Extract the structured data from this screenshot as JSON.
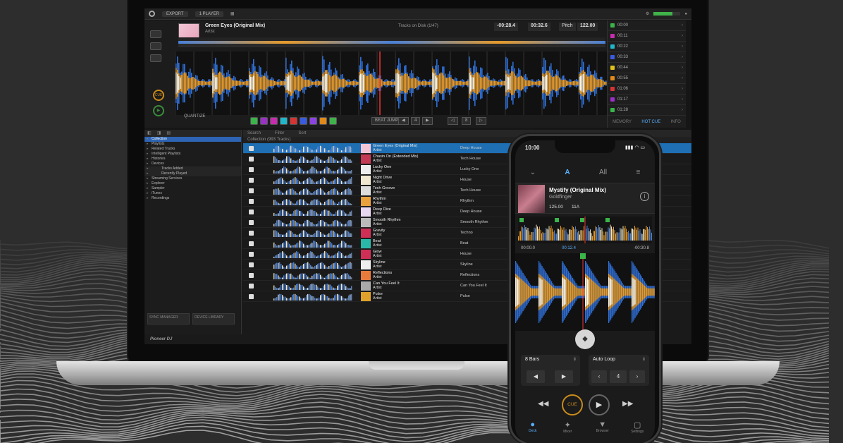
{
  "app": {
    "brand": "Pioneer DJ"
  },
  "topbar": {
    "mode_label": "EXPORT",
    "layout_label": "1 PLAYER"
  },
  "deck": {
    "title": "Green Eyes (Original Mix)",
    "artist": "Artist",
    "key": "Tracks on Disk (1/47)",
    "time_remaining": "-00:28.4",
    "time_elapsed": "00:32.6",
    "pitch_label": "Pitch",
    "bpm": "122.00",
    "cue_label": "CUE",
    "play_label": "▶",
    "quantize_label": "QUANTIZE",
    "beat_jump_label": "BEAT JUMP",
    "pad_colors": [
      "#3ab54a",
      "#9b30c9",
      "#c92bb0",
      "#1fb7c9",
      "#d63333",
      "#3a5be0",
      "#8c44e0",
      "#e08a1b",
      "#3fb24a"
    ]
  },
  "hot_cues": [
    {
      "label": "00:00",
      "color": "#3ab54a"
    },
    {
      "label": "00:11",
      "color": "#c92bb0"
    },
    {
      "label": "00:22",
      "color": "#1fb7c9"
    },
    {
      "label": "00:33",
      "color": "#3a5be0"
    },
    {
      "label": "00:44",
      "color": "#e0c21b"
    },
    {
      "label": "00:55",
      "color": "#e08a1b"
    },
    {
      "label": "01:06",
      "color": "#d63333"
    },
    {
      "label": "01:17",
      "color": "#9b30c9"
    },
    {
      "label": "01:28",
      "color": "#3ab54a"
    }
  ],
  "hot_cue_footer": [
    "MEMORY",
    "HOT CUE",
    "INFO"
  ],
  "tree": {
    "tabs": [
      "◧",
      "◨",
      "▤"
    ],
    "items": [
      {
        "label": "Collection",
        "sel": true
      },
      {
        "label": "Playlists",
        "sel": false
      },
      {
        "label": "Related Tracks",
        "sel": false
      },
      {
        "label": "Intelligent Playlists",
        "sel": false
      },
      {
        "label": "Histories",
        "sel": false
      },
      {
        "label": "Devices",
        "sel": false
      },
      {
        "label": "Tracks Added",
        "sel": false,
        "sub": true
      },
      {
        "label": "Recently Played",
        "sel": false,
        "sub": true
      },
      {
        "label": "Streaming Services",
        "sel": false
      },
      {
        "label": "Explorer",
        "sel": false
      },
      {
        "label": "Sampler",
        "sel": false
      },
      {
        "label": "iTunes",
        "sel": false
      },
      {
        "label": "Recordings",
        "sel": false
      }
    ],
    "bottom": [
      "SYNC MANAGER",
      "DEVICE LIBRARY"
    ]
  },
  "list": {
    "header": [
      "Search",
      "Filter",
      "Sort"
    ],
    "subtitle": "Collection (993 Tracks)",
    "rows": [
      {
        "title": "Green Eyes (Original Mix)",
        "artist": "Artist",
        "genre": "Deep House",
        "sel": true,
        "thumb": "#f2c6d5"
      },
      {
        "title": "Chasin On (Extended Mix)",
        "artist": "Artist",
        "genre": "Tech House",
        "sel": false,
        "thumb": "#c43a55"
      },
      {
        "title": "Lucky One",
        "artist": "Artist",
        "genre": "Lucky One",
        "sel": false,
        "thumb": "#eeeeee"
      },
      {
        "title": "Night Drive",
        "artist": "Artist",
        "genre": "House",
        "sel": false,
        "thumb": "#f0e8d0"
      },
      {
        "title": "Tech Groove",
        "artist": "Artist",
        "genre": "Tech House",
        "sel": false,
        "thumb": "#dddddd"
      },
      {
        "title": "Rhythm",
        "artist": "Artist",
        "genre": "Rhythm",
        "sel": false,
        "thumb": "#e8a13c"
      },
      {
        "title": "Deep Dive",
        "artist": "Artist",
        "genre": "Deep House",
        "sel": false,
        "thumb": "#e8d7f0"
      },
      {
        "title": "Smooth Rhythm",
        "artist": "Artist",
        "genre": "Smooth Rhythm",
        "sel": false,
        "thumb": "#bbbbbb"
      },
      {
        "title": "Gravity",
        "artist": "Artist",
        "genre": "Techno",
        "sel": false,
        "thumb": "#d02f55"
      },
      {
        "title": "Beat",
        "artist": "Artist",
        "genre": "Beat",
        "sel": false,
        "thumb": "#2bb7a8"
      },
      {
        "title": "Glow",
        "artist": "Artist",
        "genre": "House",
        "sel": false,
        "thumb": "#d02f55"
      },
      {
        "title": "Skyline",
        "artist": "Artist",
        "genre": "Skyline",
        "sel": false,
        "thumb": "#eeeeee"
      },
      {
        "title": "Reflections",
        "artist": "Artist",
        "genre": "Reflections",
        "sel": false,
        "thumb": "#e87a3c"
      },
      {
        "title": "Can You Feel It",
        "artist": "Artist",
        "genre": "Can You Feel It",
        "sel": false,
        "thumb": "#aaaaaa"
      },
      {
        "title": "Pulse",
        "artist": "Artist",
        "genre": "Pulse",
        "sel": false,
        "thumb": "#e0a22b"
      }
    ]
  },
  "phone": {
    "time": "10:00",
    "status_right": "▮▮▮ ◠ ▭",
    "tabs": [
      "⌄",
      "A",
      "All",
      "≡"
    ],
    "title": "Mystify (Original Mix)",
    "artist": "Goldfinger",
    "bpm": "125.00",
    "key": "11A",
    "time_left": "00:00.0",
    "time_mid": "00:12.4",
    "time_right": "-00:30.8",
    "loop_label": "8 Bars",
    "auto_loop_label": "Auto Loop",
    "auto_loop_value": "4",
    "cue_label": "CUE",
    "nav": [
      {
        "icon": "●",
        "label": "Deck",
        "act": true
      },
      {
        "icon": "✦",
        "label": "Mixer",
        "act": false
      },
      {
        "icon": "▼",
        "label": "Browser",
        "act": false
      },
      {
        "icon": "▢",
        "label": "Settings",
        "act": false
      }
    ]
  }
}
